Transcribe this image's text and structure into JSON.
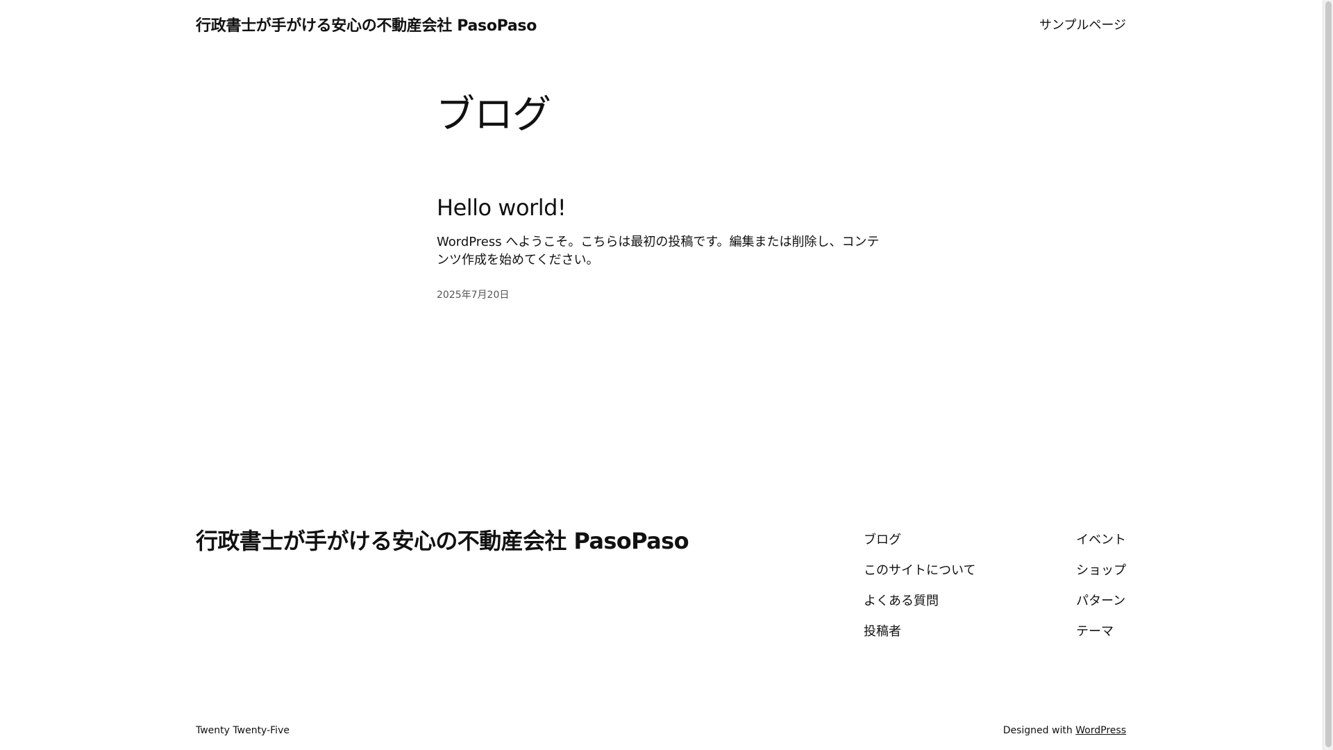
{
  "header": {
    "site_title": "行政書士が手がける安心の不動産会社 PasoPaso",
    "nav": [
      {
        "label": "サンプルページ"
      }
    ]
  },
  "main": {
    "page_heading": "ブログ",
    "posts": [
      {
        "title": "Hello world!",
        "excerpt": "WordPress へようこそ。こちらは最初の投稿です。編集または削除し、コンテンツ作成を始めてください。",
        "date": "2025年7月20日"
      }
    ]
  },
  "footer": {
    "site_title": "行政書士が手がける安心の不動産会社 PasoPaso",
    "nav_left": [
      {
        "label": "ブログ"
      },
      {
        "label": "このサイトについて"
      },
      {
        "label": "よくある質問"
      },
      {
        "label": "投稿者"
      }
    ],
    "nav_right": [
      {
        "label": "イベント"
      },
      {
        "label": "ショップ"
      },
      {
        "label": "パターン"
      },
      {
        "label": "テーマ"
      }
    ],
    "theme_name": "Twenty Twenty-Five",
    "designed_with_prefix": "Designed with",
    "designed_with_link": "WordPress"
  }
}
